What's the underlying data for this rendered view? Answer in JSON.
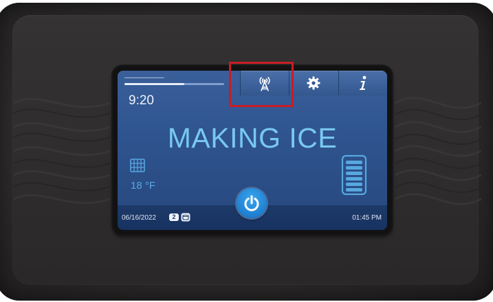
{
  "screen": {
    "progress_label": "━━━━━━━━━━━━━━━━━━",
    "progress_fraction": 0.6,
    "time": "9:20",
    "status": "MAKING ICE",
    "temperature": "18 °F",
    "date": "06/16/2022",
    "badge_count": "2",
    "clock": "01:45 PM"
  },
  "tabs": [
    {
      "name": "connectivity",
      "icon": "antenna-tower-icon"
    },
    {
      "name": "settings",
      "icon": "gear-icon"
    },
    {
      "name": "info",
      "icon": "info-icon"
    }
  ],
  "colors": {
    "screen_blue": "#2f548f",
    "status_text": "#78c8f0",
    "power_button": "#1f7fd0",
    "highlight_box": "#c81d24"
  }
}
